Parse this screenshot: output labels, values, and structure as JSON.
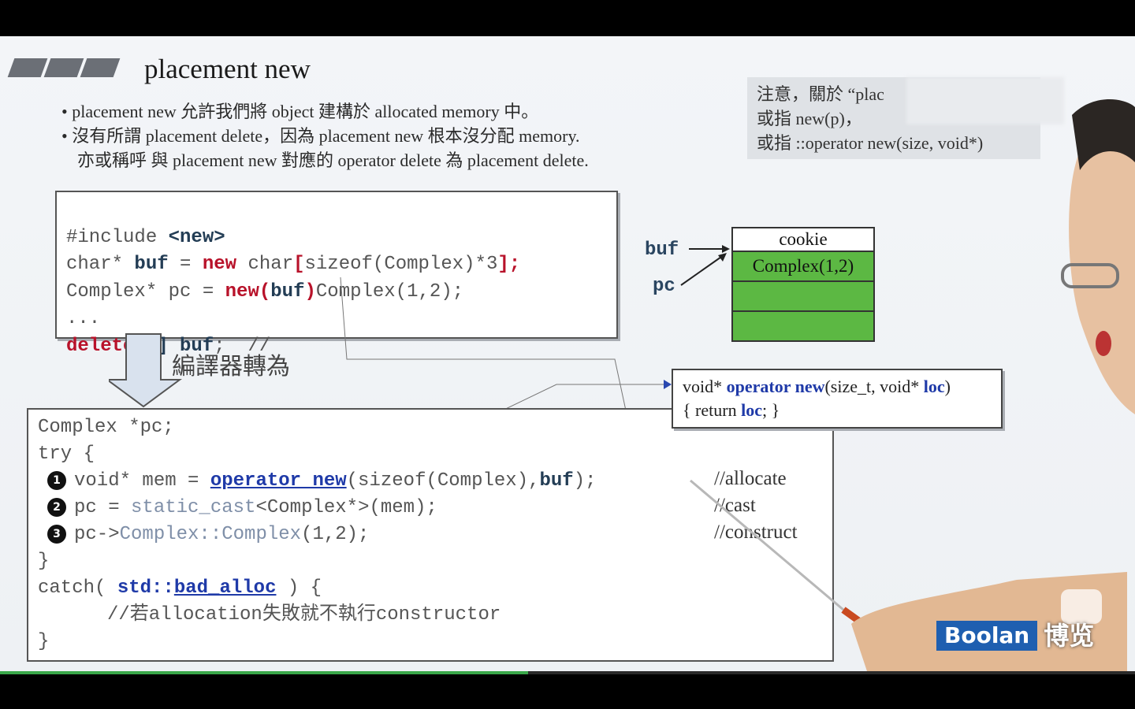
{
  "slide": {
    "title": "placement new",
    "bullets": [
      "placement new 允許我們將 object 建構於 allocated memory 中。",
      "沒有所謂 placement delete，因為 placement new 根本沒分配 memory.",
      "亦或稱呼 與 placement new 對應的 operator delete 為 placement delete."
    ],
    "note": [
      "注意，關於 “plac",
      "或指 new(p)，",
      "或指 ::operator new(size, void*)"
    ],
    "code1": {
      "l1a": "#include ",
      "l1b": "<new>",
      "l2a": "char* ",
      "l2b": "buf",
      "l2c": " = ",
      "l2d": "new",
      "l2e": " char",
      "l2f": "[",
      "l2g": "sizeof(Complex)*3",
      "l2h": "];",
      "l3a": "Complex* pc = ",
      "l3b": "new",
      "l3c": "(",
      "l3d": "buf",
      "l3e": ")",
      "l3f": "Complex(1,2);",
      "l4": "...",
      "l5a": "delete",
      "l5b": " [] ",
      "l5c": "buf",
      "l5d": ";  //"
    },
    "memory": {
      "cookie": "cookie",
      "cell1": "Complex(1,2)",
      "label_buf": "buf",
      "label_pc": "pc"
    },
    "compiler_label": "編譯器轉為",
    "operator_box": {
      "l1a": "void* ",
      "l1b": "operator new",
      "l1c": "(size_t, void* ",
      "l1d": "loc",
      "l1e": ")",
      "l2a": "{  return ",
      "l2b": "loc",
      "l2c": ";  }"
    },
    "code2": {
      "l1": "Complex *pc;",
      "l2": "try {",
      "l3a": "void* mem = ",
      "l3b": "operator new",
      "l3c": "(sizeof(Complex),",
      "l3d": "buf",
      "l3e": ");",
      "l4a": "pc = ",
      "l4b": "static_cast",
      "l4c": "<Complex*>(mem);",
      "l5a": "pc->",
      "l5b": "Complex::Complex",
      "l5c": "(1,2);",
      "l6": "}",
      "l7a": "catch( ",
      "l7b": "std::",
      "l7c": "bad_alloc",
      "l7d": " ) {",
      "l8": "//若allocation失敗就不執行constructor",
      "l9": "}",
      "nums": [
        "1",
        "2",
        "3"
      ],
      "comments": [
        "//allocate",
        "//cast",
        "//construct"
      ]
    },
    "watermark": {
      "brand": "Boolan",
      "cn": "博览"
    }
  },
  "colors": {
    "green_cell": "#5cb843",
    "keyword": "#b8122a",
    "operator": "#1f3aa8"
  }
}
